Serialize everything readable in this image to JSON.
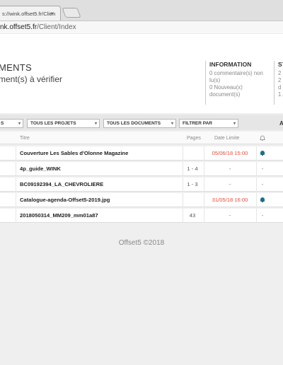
{
  "browser": {
    "tab_title": "s://wink.offset5.fr/Clien",
    "close_glyph": "×",
    "address_host": "nk.offset5.fr",
    "address_path": "/Client/Index"
  },
  "header": {
    "title": "MENTS",
    "subtitle": "ment(s) à vérifier"
  },
  "information": {
    "heading": "INFORMATION",
    "line1": "0 commentaire(s) non lu(s)",
    "line2": "0 Nouveau(x) document(s)"
  },
  "stats": {
    "heading": "ST",
    "lines": [
      "2",
      "2",
      "d",
      "1 /"
    ]
  },
  "filters": {
    "first": "S",
    "projects": "TOUS LES PROJETS",
    "documents": "TOUS LES DOCUMENTS",
    "filter_by": "FILTRER PAR",
    "right": "A",
    "arrow": "▾"
  },
  "table": {
    "headers": {
      "title": "Titre",
      "pages": "Pages",
      "date": "Date Limite"
    },
    "rows": [
      {
        "title": "Couverture Les Sables d'Olonne Magazine",
        "pages": "",
        "date": "05/06/18 15:00",
        "date_alert": true,
        "bell": "blue"
      },
      {
        "title": "4p_guide_WINK",
        "pages": "1 - 4",
        "date": "-",
        "date_alert": false,
        "bell": "-"
      },
      {
        "title": "BC09192394_LA_CHEVROLIERE",
        "pages": "1 - 3",
        "date": "-",
        "date_alert": false,
        "bell": "-"
      },
      {
        "title": "Catalogue-agenda-Offset5-2019.jpg",
        "pages": "",
        "date": "31/05/18 16:00",
        "date_alert": true,
        "bell": "blue"
      },
      {
        "title": "2018050314_MM209_mm01a87",
        "pages": "43",
        "date": "-",
        "date_alert": false,
        "bell": "-"
      }
    ]
  },
  "footer": {
    "text": "Offset5 ©2018"
  },
  "colors": {
    "alert": "#e74c3c",
    "bell": "#1f6f8b"
  }
}
